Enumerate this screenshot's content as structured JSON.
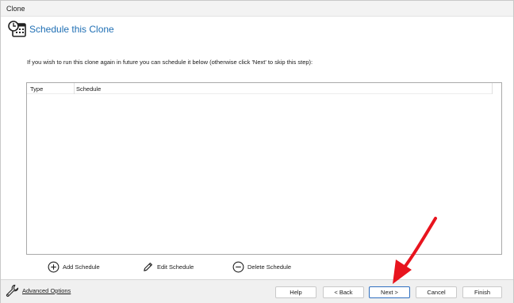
{
  "window": {
    "title": "Clone"
  },
  "header": {
    "title": "Schedule this Clone",
    "icon": "clock-calendar-icon"
  },
  "instruction": "If you wish to run this clone again in future you can schedule it below (otherwise click 'Next' to skip this step):",
  "schedule_list": {
    "columns": [
      "Type",
      "Schedule"
    ],
    "rows": []
  },
  "actions": {
    "add": {
      "label": "Add Schedule",
      "icon": "plus-circle-icon"
    },
    "edit": {
      "label": "Edit Schedule",
      "icon": "pencil-icon"
    },
    "delete": {
      "label": "Delete Schedule",
      "icon": "minus-circle-icon"
    }
  },
  "footer": {
    "advanced_options": {
      "label": "Advanced Options",
      "icon": "wrench-icon"
    },
    "buttons": {
      "help": "Help",
      "back": "< Back",
      "next": "Next >",
      "cancel": "Cancel",
      "finish": "Finish"
    }
  },
  "annotation": {
    "icon": "red-arrow-icon",
    "color": "#e8141e"
  },
  "colors": {
    "accent": "#1f6fb4",
    "primary_button_border": "#2f6fc0"
  }
}
